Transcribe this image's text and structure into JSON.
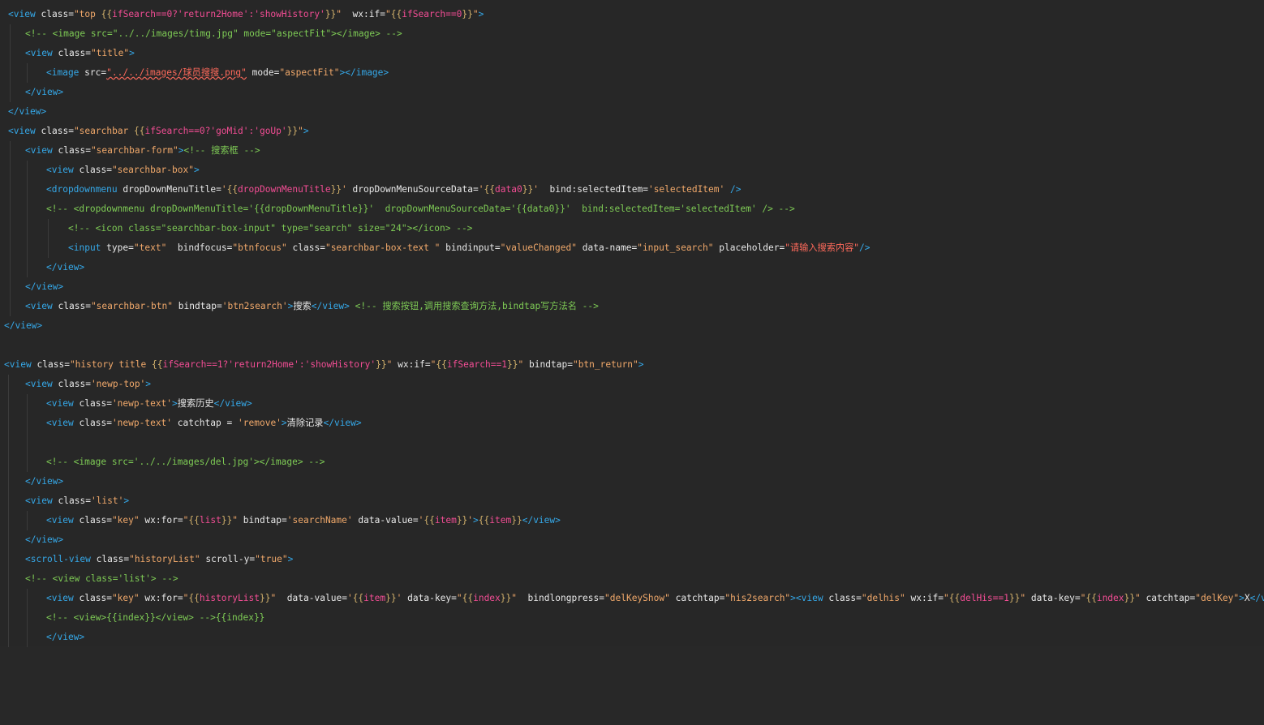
{
  "editor": {
    "theme": {
      "background": "#272727",
      "tag": "#35a8e8",
      "string": "#f0a86a",
      "comment": "#7ecb55",
      "brace": "#d1b06b",
      "red": "#ff6a5b",
      "pink": "#f24d94"
    },
    "lines": [
      "<view class=\"top {{ifSearch==0?'return2Home':'showHistory'}}\"  wx:if=\"{{ifSearch==0}}\">",
      "<!-- <image src=\"../../images/timg.jpg\" mode=\"aspectFit\"></image> -->",
      "<view class=\"title\">",
      "<image src=\"../../images/球员搜搜.png\" mode=\"aspectFit\"></image>",
      "</view>",
      "</view>",
      "<view class=\"searchbar {{ifSearch==0?'goMid':'goUp'}}\">",
      "<view class=\"searchbar-form\"><!-- 搜索框 -->",
      "<view class=\"searchbar-box\">",
      "<dropdownmenu dropDownMenuTitle='{{dropDownMenuTitle}}' dropDownMenuSourceData='{{data0}}'  bind:selectedItem='selectedItem' />",
      "<!-- <dropdownmenu dropDownMenuTitle='{{dropDownMenuTitle}}'  dropDownMenuSourceData='{{data0}}'  bind:selectedItem='selectedItem' /> -->",
      "<!-- <icon class=\"searchbar-box-input\" type=\"search\" size=\"24\"></icon> -->",
      "<input type=\"text\"  bindfocus=\"btnfocus\" class=\"searchbar-box-text \" bindinput=\"valueChanged\" data-name=\"input_search\" placeholder=\"请输入搜索内容\"/>",
      "</view>",
      "</view>",
      "<view class=\"searchbar-btn\" bindtap='btn2search'>搜索</view> <!-- 搜索按钮,调用搜索查询方法,bindtap写方法名 -->",
      "</view>",
      "",
      "<view class=\"history title {{ifSearch==1?'return2Home':'showHistory'}}\" wx:if=\"{{ifSearch==1}}\" bindtap=\"btn_return\">",
      "<view class='newp-top'>",
      "<view class='newp-text'>搜索历史</view>",
      "<view class='newp-text' catchtap = 'remove'>清除记录</view>",
      "",
      "<!-- <image src='../../images/del.jpg'></image> -->",
      "</view>",
      "<view class='list'>",
      "<view class=\"key\" wx:for=\"{{list}}\" bindtap='searchName' data-value='{{item}}'>{{item}}</view>",
      "</view>",
      "<scroll-view class=\"historyList\" scroll-y=\"true\">",
      "<!-- <view class='list'> -->",
      "<view class=\"key\" wx:for=\"{{historyList}}\"  data-value='{{item}}' data-key=\"{{index}}\"  bindlongpress=\"delKeyShow\" catchtap=\"his2search\"><view class=\"delhis\" wx:if=\"{{delHis==1}}\" data-key=\"{{index}}\" catchtap=\"delKey\">X</view>",
      "<!-- <view>{{index}}</view> -->{{index}}",
      "</view>"
    ]
  }
}
